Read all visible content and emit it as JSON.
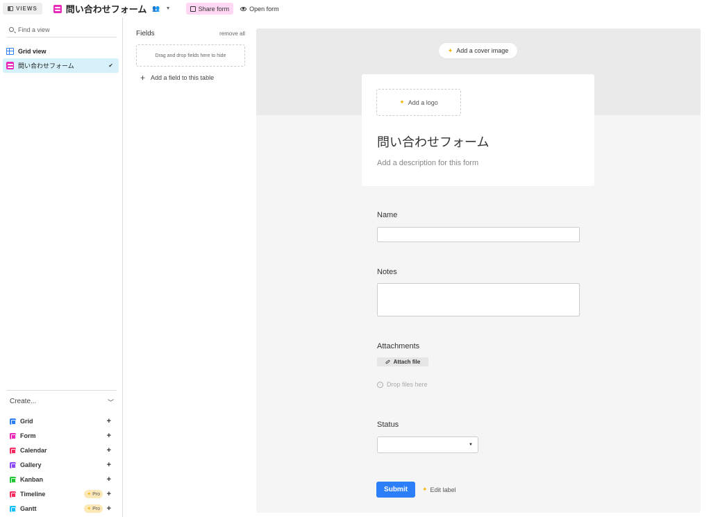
{
  "topbar": {
    "views_label": "VIEWS",
    "view_title": "問い合わせフォーム",
    "share_form": "Share form",
    "open_form": "Open form"
  },
  "sidebar": {
    "find_placeholder": "Find a view",
    "views": [
      {
        "label": "Grid view",
        "icon": "grid-icon",
        "color": "#2d7ff9",
        "active": false
      },
      {
        "label": "問い合わせフォーム",
        "icon": "form-icon",
        "color": "#e929ba",
        "active": true
      }
    ],
    "create_label": "Create...",
    "create_items": [
      {
        "label": "Grid",
        "color": "#2d7ff9",
        "pro": ""
      },
      {
        "label": "Form",
        "color": "#e929ba",
        "pro": ""
      },
      {
        "label": "Calendar",
        "color": "#f82b60",
        "pro": ""
      },
      {
        "label": "Gallery",
        "color": "#8b46ff",
        "pro": ""
      },
      {
        "label": "Kanban",
        "color": "#20c933",
        "pro": ""
      },
      {
        "label": "Timeline",
        "color": "#f82b60",
        "pro": "Pro"
      },
      {
        "label": "Gantt",
        "color": "#18bfff",
        "pro": "Pro"
      }
    ]
  },
  "fields_panel": {
    "title": "Fields",
    "remove_all": "remove all",
    "drop_hint": "Drag and drop fields here to hide",
    "add_field": "Add a field to this table"
  },
  "form": {
    "cover_button": "Add a cover image",
    "logo_button": "Add a logo",
    "title": "問い合わせフォーム",
    "description": "Add a description for this form",
    "fields": {
      "name": "Name",
      "notes": "Notes",
      "attachments": "Attachments",
      "attach_file": "Attach file",
      "drop_files": "Drop files here",
      "status": "Status"
    },
    "submit": "Submit",
    "edit_label": "Edit label"
  }
}
